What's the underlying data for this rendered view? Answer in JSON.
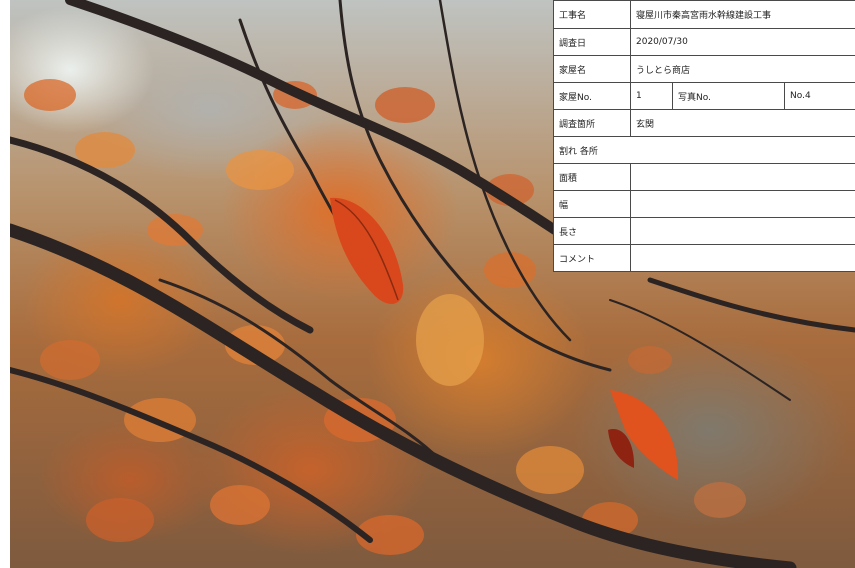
{
  "survey_form": {
    "rows": {
      "koji_mei": {
        "label": "工事名",
        "value": "寝屋川市秦高宮雨水幹線建設工事"
      },
      "chosa_bi": {
        "label": "調査日",
        "value": "2020/07/30"
      },
      "kaoku_mei": {
        "label": "家屋名",
        "value": "うしとら商店"
      },
      "kaoku_no": {
        "label": "家屋No.",
        "value": "1",
        "photo_label": "写真No.",
        "photo_value": "No.4"
      },
      "chosa_kasho": {
        "label": "調査箇所",
        "value": "玄関"
      },
      "wareme": {
        "label": "割れ 各所"
      },
      "menseki": {
        "label": "面積",
        "value": ""
      },
      "haba": {
        "label": "幅",
        "value": ""
      },
      "nagasa": {
        "label": "長さ",
        "value": ""
      },
      "comment": {
        "label": "コメント",
        "value": ""
      }
    }
  },
  "colors": {
    "border": "#4a4a4a",
    "branch": "#2b2422",
    "leaf_red": "#d9481c",
    "leaf_orange": "#e08a3a"
  }
}
